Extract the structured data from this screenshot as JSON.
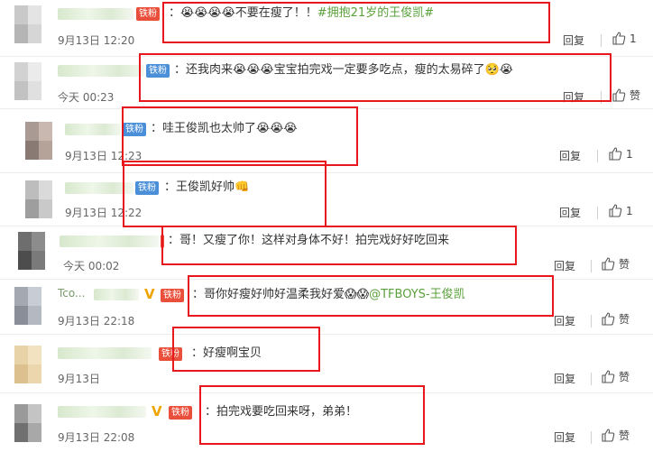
{
  "comments": [
    {
      "badge": "铁粉",
      "text": "：😭😭😭😭不要在瘦了！！",
      "hashtag": "#拥抱21岁的王俊凯#",
      "time": "9月13日 12:20",
      "reply": "回复",
      "like": "1"
    },
    {
      "badge": "铁粉",
      "text": "：还我肉来😭😭😭宝宝拍完戏一定要多吃点，瘦的太易碎了🥺😭",
      "time": "今天 00:23",
      "reply": "回复",
      "like": "赞"
    },
    {
      "badge": "铁粉",
      "text": "：哇王俊凯也太帅了😭😭😭",
      "time": "9月13日 12:23",
      "reply": "回复",
      "like": "1"
    },
    {
      "badge": "铁粉",
      "text": "：王俊凯好帅👊",
      "time": "9月13日 12:22",
      "reply": "回复",
      "like": "1"
    },
    {
      "badge": "",
      "text": "：哥！又瘦了你！这样对身体不好！拍完戏好好吃回来",
      "time": "今天 00:02",
      "reply": "回复",
      "like": "赞"
    },
    {
      "name_prefix": "Tco...",
      "badge": "铁粉",
      "text": "：哥你好瘦好帅好温柔我好爱😱😱",
      "mention": "@TFBOYS-王俊凯",
      "time": "9月13日 22:18",
      "reply": "回复",
      "like": "赞"
    },
    {
      "badge": "铁粉",
      "text": "：好瘦啊宝贝",
      "time": "9月13日",
      "reply": "回复",
      "like": "赞"
    },
    {
      "badge": "铁粉",
      "text": "：拍完戏要吃回来呀，弟弟！",
      "time": "9月13日 22:08",
      "reply": "回复",
      "like": "赞"
    }
  ]
}
